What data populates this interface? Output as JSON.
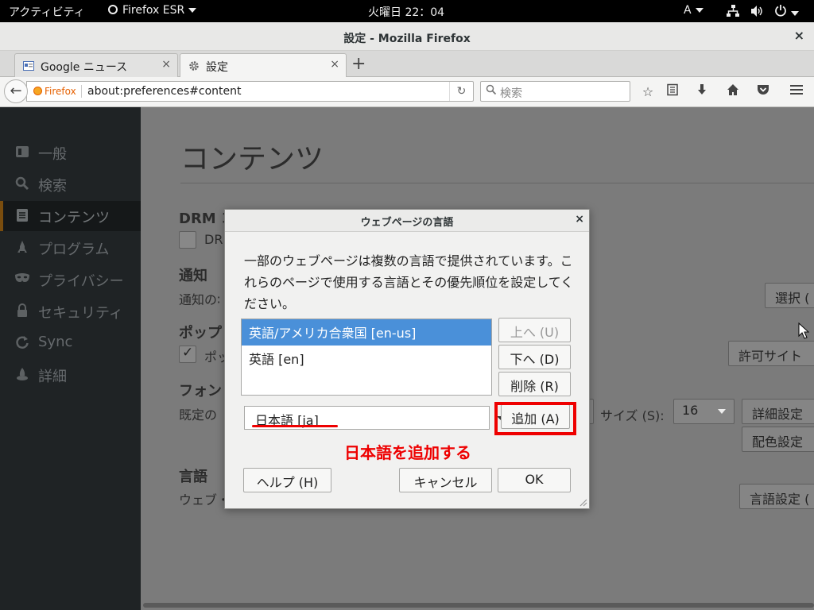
{
  "topbar": {
    "activities": "アクティビティ",
    "app_menu": "Firefox ESR",
    "clock": "火曜日 22：04",
    "input_method": "A"
  },
  "window": {
    "title": "設定 - Mozilla Firefox",
    "close": "×"
  },
  "tabs": [
    {
      "label": "Google ニュース",
      "active": false
    },
    {
      "label": "設定",
      "active": true
    }
  ],
  "tab_close": "×",
  "new_tab": "+",
  "navbar": {
    "identity": "Firefox",
    "url": "about:preferences#content",
    "search_placeholder": "検索"
  },
  "sidebar": {
    "items": [
      {
        "label": "一般",
        "icon": "general-icon",
        "active": false
      },
      {
        "label": "検索",
        "icon": "search-icon",
        "active": false
      },
      {
        "label": "コンテンツ",
        "icon": "content-icon",
        "active": true
      },
      {
        "label": "プログラム",
        "icon": "applications-icon",
        "active": false
      },
      {
        "label": "プライバシー",
        "icon": "privacy-mask-icon",
        "active": false
      },
      {
        "label": "セキュリティ",
        "icon": "security-lock-icon",
        "active": false
      },
      {
        "label": "Sync",
        "icon": "sync-icon",
        "active": false
      },
      {
        "label": "詳細",
        "icon": "advanced-icon",
        "active": false
      }
    ]
  },
  "main": {
    "title": "コンテンツ",
    "drm": {
      "heading": "DRM コ",
      "checkbox_label": "DR"
    },
    "notifications": {
      "heading": "通知",
      "text": "通知の∶",
      "button": "選択 ("
    },
    "popups": {
      "heading": "ポップ",
      "checkbox_label": "ポッ",
      "button": "許可サイト"
    },
    "fonts": {
      "heading": "フォン",
      "text": "既定の",
      "size_label": "サイズ (S):",
      "size_value": "16",
      "advanced_button": "詳細設定",
      "colors_button": "配色設定"
    },
    "languages": {
      "heading": "言語",
      "text": "ウェブ・",
      "button": "言語設定 ("
    }
  },
  "dialog": {
    "title": "ウェブページの言語",
    "close": "×",
    "description": "一部のウェブページは複数の言語で提供されています。これらのページで使用する言語とその優先順位を設定してください。",
    "languages": [
      {
        "label": "英語/アメリカ合衆国  [en-us]",
        "selected": true
      },
      {
        "label": "英語  [en]",
        "selected": false
      }
    ],
    "move_up": "上へ (U)",
    "move_down": "下へ (D)",
    "remove": "削除 (R)",
    "add_select_value": "日本語  [ja]",
    "add_button": "追加 (A)",
    "help_button": "ヘルプ (H)",
    "cancel_button": "キャンセル",
    "ok_button": "OK"
  },
  "annotation": {
    "text": "日本語を追加する",
    "color": "#ee0000"
  },
  "colors": {
    "selection": "#4a90d9",
    "sidebar_bg": "#1f2325",
    "accent_orange": "#e66000"
  }
}
